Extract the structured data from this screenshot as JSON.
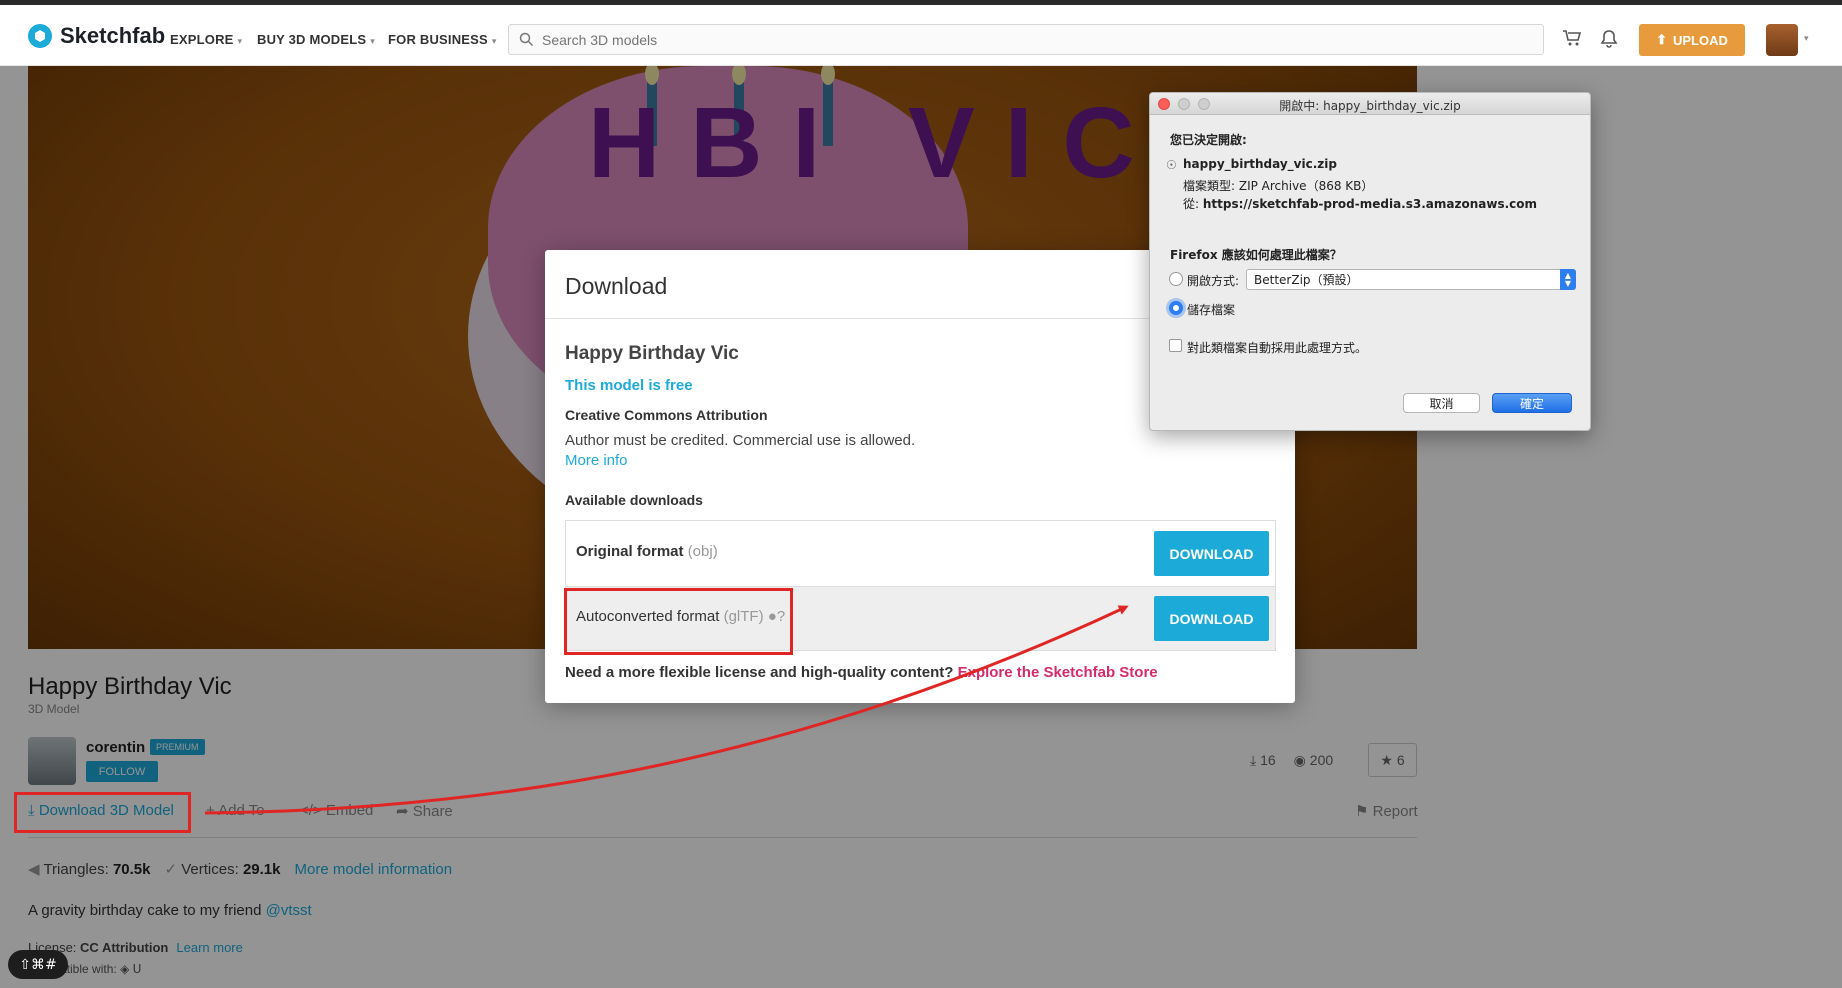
{
  "navbar": {
    "brand": "Sketchfab",
    "explore": "EXPLORE",
    "buy": "BUY 3D MODELS",
    "business": "FOR BUSINESS",
    "search_placeholder": "Search 3D models",
    "upload": "UPLOAD"
  },
  "viewer": {
    "cake_text": "HBI VIC"
  },
  "model": {
    "title": "Happy Birthday Vic",
    "subtitle": "3D Model",
    "author": "corentin",
    "author_badge": "PREMIUM",
    "follow": "FOLLOW",
    "downloads_count": "16",
    "views_count": "200",
    "likes_count": "6",
    "actions": {
      "download": "Download 3D Model",
      "add_to": "Add To",
      "embed": "Embed",
      "share": "Share",
      "report": "Report"
    },
    "triangles_label": "Triangles:",
    "triangles": "70.5k",
    "vertices_label": "Vertices:",
    "vertices": "29.1k",
    "more_info": "More model information",
    "description": "A gravity birthday cake to my friend",
    "mention": "@vtsst",
    "license_label": "License:",
    "license": "CC Attribution",
    "learn_more": "Learn more",
    "compat_label": "Compatible with:"
  },
  "modal": {
    "title": "Download",
    "model_name": "Happy Birthday Vic",
    "free": "This model is free",
    "license_title": "Creative Commons Attribution",
    "license_desc": "Author must be credited. Commercial use is allowed.",
    "more_info": "More info",
    "available": "Available downloads",
    "rows": [
      {
        "label": "Original format",
        "format": "(obj)",
        "button": "DOWNLOAD"
      },
      {
        "label": "Autoconverted format",
        "format": "(glTF)",
        "button": "DOWNLOAD"
      }
    ],
    "footer_text": "Need a more flexible license and high-quality content?",
    "footer_link": "Explore the Sketchfab Store"
  },
  "firefox": {
    "title": "開啟中: happy_birthday_vic.zip",
    "decided": "您已決定開啟:",
    "filename": "happy_birthday_vic.zip",
    "filetype": "檔案類型: ZIP Archive（868 KB）",
    "from_label": "從:",
    "from_url": "https://sketchfab-prod-media.s3.amazonaws.com",
    "question": "Firefox 應該如何處理此檔案？",
    "open_with_label": "開啟方式:",
    "open_with_value": "BetterZip（預設）",
    "save_file": "儲存檔案",
    "auto_apply": "對此類檔案自動採用此處理方式。",
    "cancel": "取消",
    "ok": "確定"
  },
  "shortcut_badge": "⇧⌘#",
  "colors": {
    "accent": "#1caad9",
    "upload": "#e89b3c",
    "store_link": "#d52a6b",
    "annotation": "#e02525"
  }
}
